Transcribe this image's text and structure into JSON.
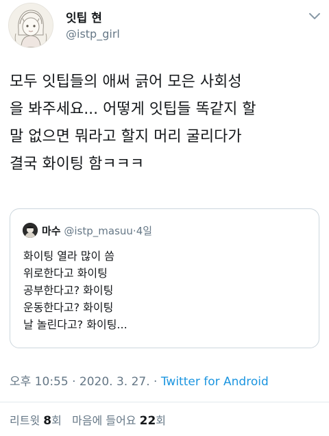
{
  "author": {
    "display_name": "잇팁 현",
    "handle": "@istp_girl"
  },
  "tweet": {
    "text": "모두 잇팁들의 애써 긁어 모은 사회성\n을 봐주세요... 어떻게 잇팁들 똑같지 할\n말 없으면 뭐라고 할지 머리 굴리다가\n결국 화이팅 함ㅋㅋㅋ"
  },
  "quoted_tweet": {
    "display_name": "마수",
    "handle": "@istp_masuu",
    "separator": "·",
    "time": "4일",
    "text": "화이팅 열라 많이 씀\n위로한다고 화이팅\n공부한다고? 화이팅\n운동한다고? 화이팅\n날 놀린다고? 화이팅..."
  },
  "meta": {
    "time": "오후 10:55",
    "separator1": "·",
    "date": "2020. 3. 27.",
    "separator2": "·",
    "source": "Twitter for Android"
  },
  "stats": {
    "retweets_label": "리트윗",
    "retweets_count": "8",
    "retweets_suffix": "회",
    "likes_label": "마음에 들어요",
    "likes_count": "22",
    "likes_suffix": "회"
  },
  "icons": {
    "menu": "chevron-down-icon"
  },
  "colors": {
    "text": "#14171a",
    "secondary": "#657786",
    "link": "#1b95e0",
    "border": "#ccd6dd"
  }
}
